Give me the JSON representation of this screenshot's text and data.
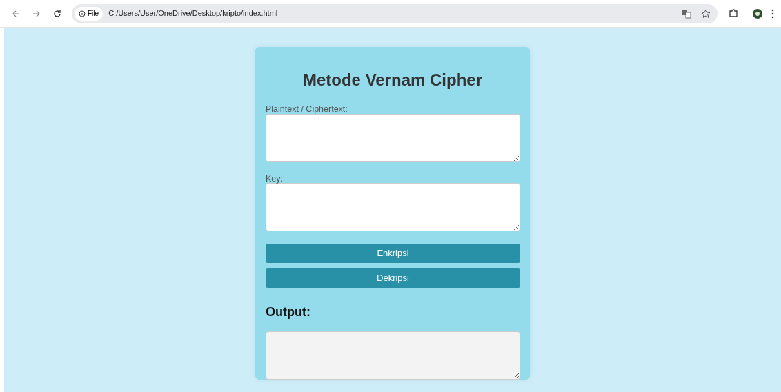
{
  "browser": {
    "site_chip": "File",
    "url": "C:/Users/User/OneDrive/Desktop/kripto/index.html"
  },
  "card": {
    "title": "Metode Vernam Cipher",
    "fields": [
      {
        "label": "Plaintext / Ciphertext:"
      },
      {
        "label": "Key:"
      }
    ],
    "buttons": [
      "Enkripsi",
      "Dekripsi"
    ],
    "output": {
      "heading": "Output:",
      "readonly": true
    }
  }
}
